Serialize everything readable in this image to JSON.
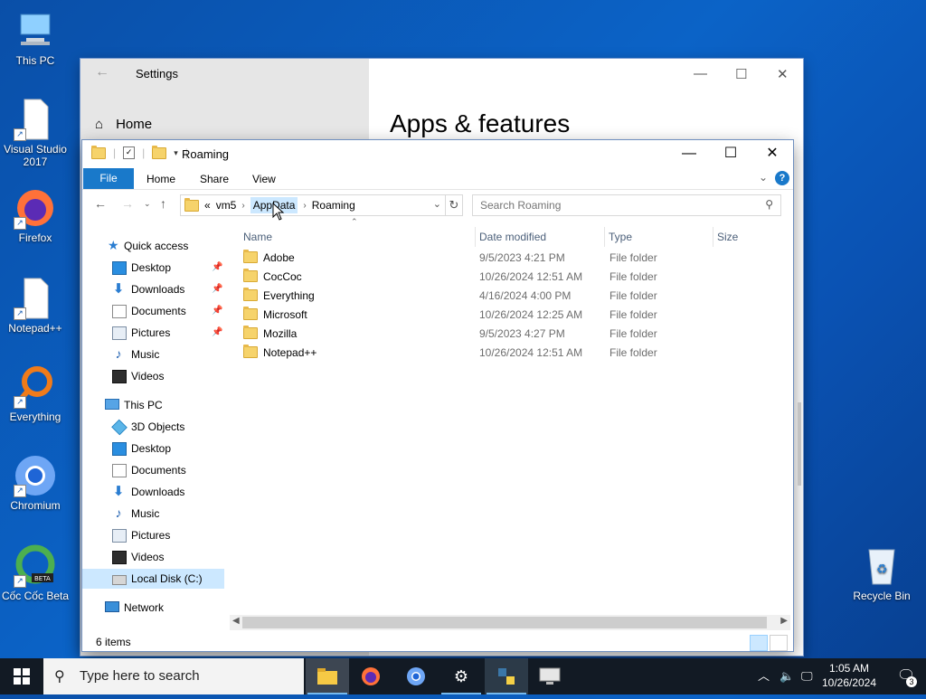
{
  "desktop": {
    "icons": [
      {
        "label": "This PC"
      },
      {
        "label": "Visual Studio 2017"
      },
      {
        "label": "Firefox"
      },
      {
        "label": "Notepad++"
      },
      {
        "label": "Everything"
      },
      {
        "label": "Chromium"
      },
      {
        "label": "Cốc Cốc Beta"
      },
      {
        "label": "Recycle Bin"
      }
    ]
  },
  "settings": {
    "title": "Settings",
    "home": "Home",
    "heading": "Apps & features"
  },
  "explorer": {
    "title": "Roaming",
    "ribbon": {
      "file": "File",
      "home": "Home",
      "share": "Share",
      "view": "View",
      "help": "?"
    },
    "address": {
      "prefix": "«",
      "segments": [
        "vm5",
        "AppData",
        "Roaming"
      ]
    },
    "search_placeholder": "Search Roaming",
    "nav": {
      "quick_access": "Quick access",
      "quick": [
        {
          "label": "Desktop",
          "icon": "desktop-icon"
        },
        {
          "label": "Downloads",
          "icon": "download-icon"
        },
        {
          "label": "Documents",
          "icon": "document-icon"
        },
        {
          "label": "Pictures",
          "icon": "pictures-icon"
        },
        {
          "label": "Music",
          "icon": "music-icon"
        },
        {
          "label": "Videos",
          "icon": "videos-icon"
        }
      ],
      "this_pc": "This PC",
      "pc": [
        {
          "label": "3D Objects"
        },
        {
          "label": "Desktop"
        },
        {
          "label": "Documents"
        },
        {
          "label": "Downloads"
        },
        {
          "label": "Music"
        },
        {
          "label": "Pictures"
        },
        {
          "label": "Videos"
        },
        {
          "label": "Local Disk (C:)"
        }
      ],
      "network": "Network"
    },
    "columns": {
      "name": "Name",
      "date": "Date modified",
      "type": "Type",
      "size": "Size"
    },
    "files": [
      {
        "name": "Adobe",
        "date": "9/5/2023 4:21 PM",
        "type": "File folder"
      },
      {
        "name": "CocCoc",
        "date": "10/26/2024 12:51 AM",
        "type": "File folder"
      },
      {
        "name": "Everything",
        "date": "4/16/2024 4:00 PM",
        "type": "File folder"
      },
      {
        "name": "Microsoft",
        "date": "10/26/2024 12:25 AM",
        "type": "File folder"
      },
      {
        "name": "Mozilla",
        "date": "9/5/2023 4:27 PM",
        "type": "File folder"
      },
      {
        "name": "Notepad++",
        "date": "10/26/2024 12:51 AM",
        "type": "File folder"
      }
    ],
    "status": "6 items"
  },
  "taskbar": {
    "search_placeholder": "Type here to search",
    "time": "1:05 AM",
    "date": "10/26/2024",
    "notification_count": "3"
  }
}
